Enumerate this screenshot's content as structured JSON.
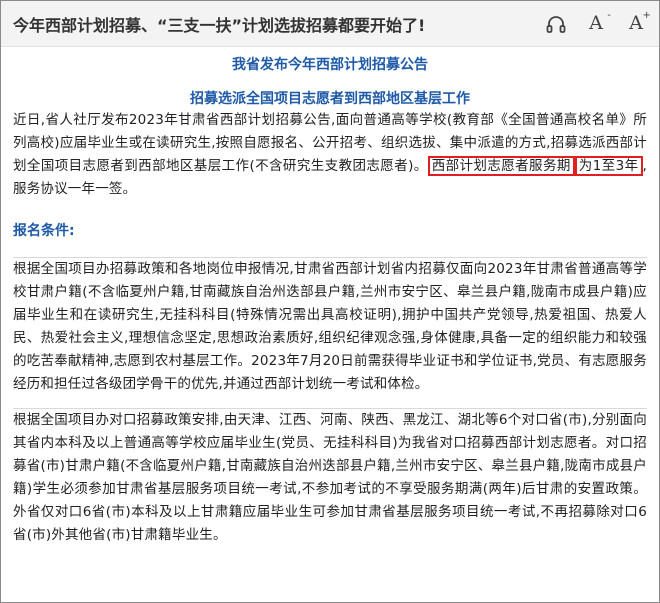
{
  "header": {
    "title": "今年西部计划招募、“三支一扶”计划选拔招募都要开始了!",
    "icons": [
      "headphones-icon",
      "font-decrease-icon",
      "font-increase-icon"
    ],
    "font_letter": "A",
    "minus": "-",
    "plus": "+"
  },
  "article": {
    "heading1": "我省发布今年西部计划招募公告",
    "heading2": "招募选派全国项目志愿者到西部地区基层工作",
    "para1_before": "近日,省人社厅发布2023年甘肃省西部计划招募公告,面向普通高等学校(教育部《全国普通高校名单》所列高校)应届毕业生或在读研究生,按照自愿报名、公开招考、组织选拔、集中派遣的方式,招募选派西部计划全国项目志愿者到西部地区基层工作(不含研究生支教团志愿者)。",
    "para1_hl_a": "西部计划志愿者服务期",
    "para1_hl_b": "为1至3年",
    "para1_after": ",服务协议一年一签。",
    "section_title": "报名条件:",
    "para2": "根据全国项目办招募政策和各地岗位申报情况,甘肃省西部计划省内招募仅面向2023年甘肃省普通高等学校甘肃户籍(不含临夏州户籍,甘南藏族自治州迭部县户籍,兰州市安宁区、皋兰县户籍,陇南市成县户籍)应届毕业生和在读研究生,无挂科科目(特殊情况需出具高校证明),拥护中国共产党领导,热爱祖国、热爱人民、热爱社会主义,理想信念坚定,思想政治素质好,组织纪律观念强,身体健康,具备一定的组织能力和较强的吃苦奉献精神,志愿到农村基层工作。2023年7月20日前需获得毕业证书和学位证书,党员、有志愿服务经历和担任过各级团学骨干的优先,并通过西部计划统一考试和体检。",
    "para3": "根据全国项目办对口招募政策安排,由天津、江西、河南、陕西、黑龙江、湖北等6个对口省(市),分别面向其省内本科及以上普通高等学校应届毕业生(党员、无挂科科目)为我省对口招募西部计划志愿者。对口招募省(市)甘肃户籍(不含临夏州户籍,甘南藏族自治州迭部县户籍,兰州市安宁区、皋兰县户籍,陇南市成县户籍)学生必须参加甘肃省基层服务项目统一考试,不参加考试的不享受服务期满(两年)后甘肃的安置政策。外省仅对口6省(市)本科及以上甘肃籍应届毕业生可参加甘肃省基层服务项目统一考试,不再招募除对口6省(市)外其他省(市)甘肃籍毕业生。"
  },
  "colors": {
    "heading": "#1f5aa8",
    "highlight_border": "#e0201e"
  }
}
